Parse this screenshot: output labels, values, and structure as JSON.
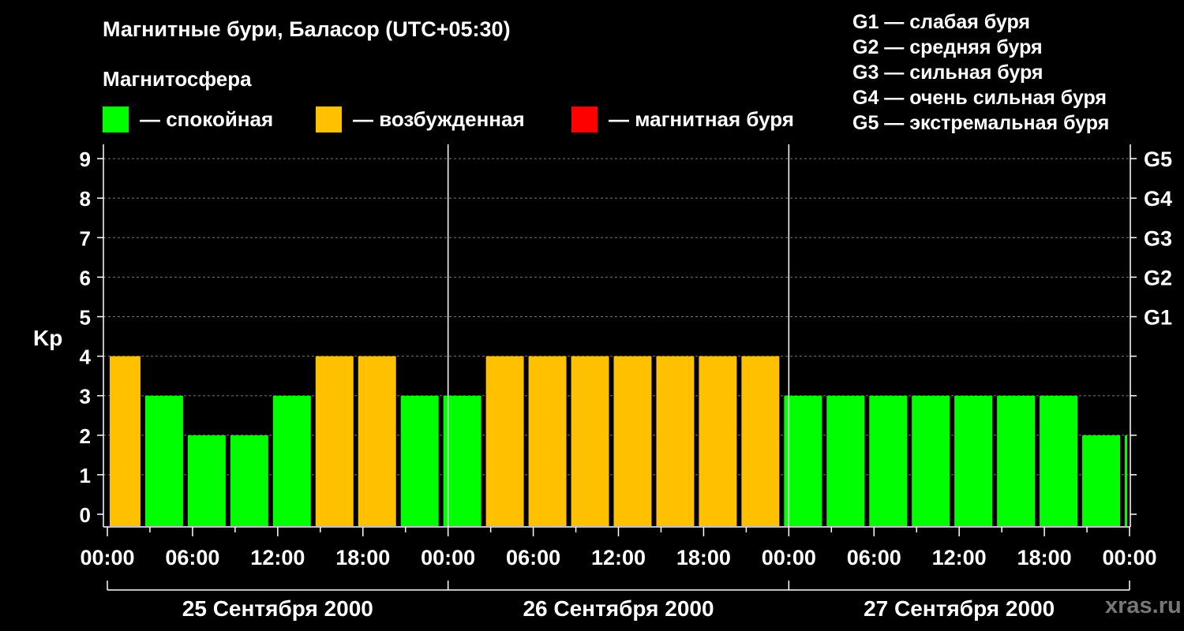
{
  "title": "Магнитные бури, Баласор (UTC+05:30)",
  "legend": {
    "heading": "Магнитосфера",
    "items": [
      {
        "label": "— спокойная",
        "color": "#00ff00"
      },
      {
        "label": "— возбужденная",
        "color": "#ffc000"
      },
      {
        "label": "— магнитная буря",
        "color": "#ff0000"
      }
    ]
  },
  "g_scale": [
    "G1 — слабая буря",
    "G2 — средняя буря",
    "G3 — сильная буря",
    "G4 — очень сильная буря",
    "G5 — экстремальная буря"
  ],
  "watermark": "xras.ru",
  "chart_data": {
    "type": "bar",
    "ylabel": "Kp",
    "ylim": [
      0,
      9
    ],
    "yticks": [
      0,
      1,
      2,
      3,
      4,
      5,
      6,
      7,
      8,
      9
    ],
    "right_axis_labels": [
      {
        "value": 5,
        "label": "G1"
      },
      {
        "value": 6,
        "label": "G2"
      },
      {
        "value": 7,
        "label": "G3"
      },
      {
        "value": 8,
        "label": "G4"
      },
      {
        "value": 9,
        "label": "G5"
      }
    ],
    "grid": "horizontal dashed",
    "x_start": "2000-09-25 00:00",
    "x_end": "2000-09-28 00:00",
    "x_tick_labels": [
      "00:00",
      "06:00",
      "12:00",
      "18:00",
      "00:00",
      "06:00",
      "12:00",
      "18:00",
      "00:00",
      "06:00",
      "12:00",
      "18:00",
      "00:00"
    ],
    "day_labels": [
      "25 Сентября 2000",
      "26 Сентября 2000",
      "27 Сентября 2000"
    ],
    "bars": [
      {
        "start": "2000-09-25 00:00",
        "end": "2000-09-25 02:30",
        "kp": 4,
        "status": "возбужденная"
      },
      {
        "start": "2000-09-25 02:30",
        "end": "2000-09-25 05:30",
        "kp": 3,
        "status": "спокойная"
      },
      {
        "start": "2000-09-25 05:30",
        "end": "2000-09-25 08:30",
        "kp": 2,
        "status": "спокойная"
      },
      {
        "start": "2000-09-25 08:30",
        "end": "2000-09-25 11:30",
        "kp": 2,
        "status": "спокойная"
      },
      {
        "start": "2000-09-25 11:30",
        "end": "2000-09-25 14:30",
        "kp": 3,
        "status": "спокойная"
      },
      {
        "start": "2000-09-25 14:30",
        "end": "2000-09-25 17:30",
        "kp": 4,
        "status": "возбужденная"
      },
      {
        "start": "2000-09-25 17:30",
        "end": "2000-09-25 20:30",
        "kp": 4,
        "status": "возбужденная"
      },
      {
        "start": "2000-09-25 20:30",
        "end": "2000-09-25 23:30",
        "kp": 3,
        "status": "спокойная"
      },
      {
        "start": "2000-09-25 23:30",
        "end": "2000-09-26 02:30",
        "kp": 3,
        "status": "спокойная"
      },
      {
        "start": "2000-09-26 02:30",
        "end": "2000-09-26 05:30",
        "kp": 4,
        "status": "возбужденная"
      },
      {
        "start": "2000-09-26 05:30",
        "end": "2000-09-26 08:30",
        "kp": 4,
        "status": "возбужденная"
      },
      {
        "start": "2000-09-26 08:30",
        "end": "2000-09-26 11:30",
        "kp": 4,
        "status": "возбужденная"
      },
      {
        "start": "2000-09-26 11:30",
        "end": "2000-09-26 14:30",
        "kp": 4,
        "status": "возбужденная"
      },
      {
        "start": "2000-09-26 14:30",
        "end": "2000-09-26 17:30",
        "kp": 4,
        "status": "возбужденная"
      },
      {
        "start": "2000-09-26 17:30",
        "end": "2000-09-26 20:30",
        "kp": 4,
        "status": "возбужденная"
      },
      {
        "start": "2000-09-26 20:30",
        "end": "2000-09-26 23:30",
        "kp": 4,
        "status": "возбужденная"
      },
      {
        "start": "2000-09-26 23:30",
        "end": "2000-09-27 02:30",
        "kp": 3,
        "status": "спокойная"
      },
      {
        "start": "2000-09-27 02:30",
        "end": "2000-09-27 05:30",
        "kp": 3,
        "status": "спокойная"
      },
      {
        "start": "2000-09-27 05:30",
        "end": "2000-09-27 08:30",
        "kp": 3,
        "status": "спокойная"
      },
      {
        "start": "2000-09-27 08:30",
        "end": "2000-09-27 11:30",
        "kp": 3,
        "status": "спокойная"
      },
      {
        "start": "2000-09-27 11:30",
        "end": "2000-09-27 14:30",
        "kp": 3,
        "status": "спокойная"
      },
      {
        "start": "2000-09-27 14:30",
        "end": "2000-09-27 17:30",
        "kp": 3,
        "status": "спокойная"
      },
      {
        "start": "2000-09-27 17:30",
        "end": "2000-09-27 20:30",
        "kp": 3,
        "status": "спокойная"
      },
      {
        "start": "2000-09-27 20:30",
        "end": "2000-09-27 23:30",
        "kp": 2,
        "status": "спокойная"
      },
      {
        "start": "2000-09-27 23:30",
        "end": "2000-09-28 00:00",
        "kp": 2,
        "status": "спокойная"
      }
    ]
  }
}
